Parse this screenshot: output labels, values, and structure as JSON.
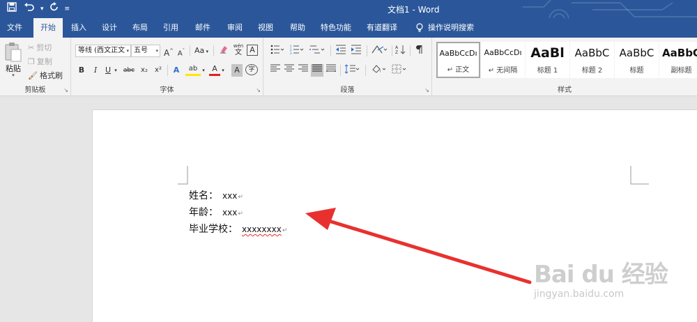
{
  "window": {
    "title": "文档1  -  Word"
  },
  "quick_access": {
    "save": "save-icon",
    "undo": "undo-icon",
    "redo": "redo-icon",
    "customize": "customize-icon"
  },
  "tabs": [
    {
      "label": "文件"
    },
    {
      "label": "开始",
      "active": true
    },
    {
      "label": "插入"
    },
    {
      "label": "设计"
    },
    {
      "label": "布局"
    },
    {
      "label": "引用"
    },
    {
      "label": "邮件"
    },
    {
      "label": "审阅"
    },
    {
      "label": "视图"
    },
    {
      "label": "帮助"
    },
    {
      "label": "特色功能"
    },
    {
      "label": "有道翻译"
    }
  ],
  "tell_me": "操作说明搜索",
  "ribbon": {
    "clipboard": {
      "label": "剪贴板",
      "paste": "粘贴",
      "cut": "剪切",
      "copy": "复制",
      "format_painter": "格式刷"
    },
    "font": {
      "label": "字体",
      "font_name": "等线 (西文正文",
      "font_size": "五号",
      "grow": "A",
      "shrink": "A",
      "change_case": "Aa",
      "phonetic": "wén",
      "bold": "B",
      "italic": "I",
      "underline": "U",
      "strikethrough": "abc",
      "subscript": "x₂",
      "superscript": "x²",
      "text_effect": "A",
      "highlight": "ab",
      "font_color": "A",
      "char_shade": "A",
      "enclose": "字",
      "char_border": "A"
    },
    "paragraph": {
      "label": "段落"
    },
    "styles": {
      "label": "样式",
      "items": [
        {
          "preview": "AaBbCcDı",
          "name": "↵ 正文"
        },
        {
          "preview": "AaBbCcDı",
          "name": "↵ 无间隔"
        },
        {
          "preview": "AaBl",
          "name": "标题 1"
        },
        {
          "preview": "AaBbC",
          "name": "标题 2"
        },
        {
          "preview": "AaBbC",
          "name": "标题"
        },
        {
          "preview": "AaBbC",
          "name": "副标题"
        }
      ]
    }
  },
  "document": {
    "lines": [
      {
        "label": "姓名：",
        "value": "xxx",
        "mark": "↵"
      },
      {
        "label": "年龄：",
        "value": "xxx",
        "mark": "↵"
      },
      {
        "label": "毕业学校：",
        "value": "xxxxxxxx",
        "mark": "↵"
      }
    ]
  },
  "watermark": {
    "main": "Bai du 经验",
    "sub": "jingyan.baidu.com"
  },
  "colors": {
    "accent": "#2b579a",
    "arrow": "#e8312f"
  }
}
